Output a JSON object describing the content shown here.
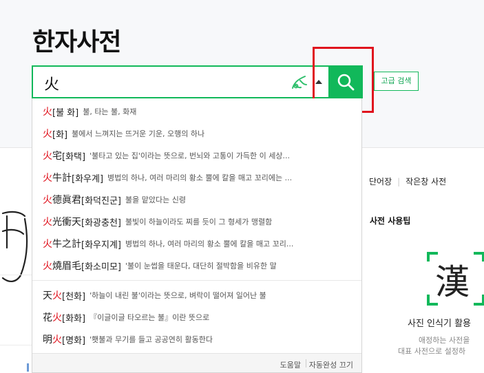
{
  "page": {
    "title": "한자사전"
  },
  "search": {
    "value": "火",
    "advanced_label": "고급 검색"
  },
  "autocomplete": {
    "group1": [
      {
        "pre": "",
        "hl": "火",
        "post": "",
        "reading": "[불 화]",
        "gloss": "불, 타는 불, 화재"
      },
      {
        "pre": "",
        "hl": "火",
        "post": "",
        "reading": "[화]",
        "gloss": "불에서 느껴지는 뜨거운 기운, 오행의 하나"
      },
      {
        "pre": "",
        "hl": "火",
        "post": "宅",
        "reading": "[화택]",
        "gloss": "'불타고 있는 집'이라는 뜻으로, 번뇌와 고통이 가득한 이 세상..."
      },
      {
        "pre": "",
        "hl": "火",
        "post": "牛計",
        "reading": "[화우계]",
        "gloss": "병법의 하나, 여러 마리의 황소 뿔에 칼을 매고 꼬리에는 ..."
      },
      {
        "pre": "",
        "hl": "火",
        "post": "德眞君",
        "reading": "[화덕진군]",
        "gloss": "불을 맡았다는 신령"
      },
      {
        "pre": "",
        "hl": "火",
        "post": "光衝天",
        "reading": "[화광충천]",
        "gloss": "불빛이 하늘이라도 찌를 듯이 그 형세가 맹렬함"
      },
      {
        "pre": "",
        "hl": "火",
        "post": "牛之計",
        "reading": "[화우지계]",
        "gloss": "병법의 하나, 여러 마리의 황소 뿔에 칼을 매고 꼬리..."
      },
      {
        "pre": "",
        "hl": "火",
        "post": "燒眉毛",
        "reading": "[화소미모]",
        "gloss": "'불이 눈썹을 태운다, 대단히 절박함을 비유한 말"
      }
    ],
    "group2": [
      {
        "pre": "天",
        "hl": "火",
        "post": "",
        "reading": "[천화]",
        "gloss": "'하늘이 내린 불'이라는 뜻으로, 벼락이 떨어져 일어난 불"
      },
      {
        "pre": "花",
        "hl": "火",
        "post": "",
        "reading": "[화화]",
        "gloss": "『이글이글 타오르는 불』이란 뜻으로"
      },
      {
        "pre": "明",
        "hl": "火",
        "post": "",
        "reading": "[명화]",
        "gloss": "'횃불과 무기를 들고 공공연히 활동한다"
      }
    ],
    "footer": {
      "help": "도움말",
      "auto_off": "자동완성 끄기"
    }
  },
  "sidebar": {
    "links": [
      "단어장",
      "작은창 사전"
    ],
    "tips_title": "사전 사용팁",
    "scanner": {
      "char": "漢",
      "title": "사진 인식기 활용",
      "desc1": "애정하는 사전을",
      "desc2": "대표 사전으로 설정하"
    }
  },
  "colors": {
    "brand": "#11b85a",
    "highlight": "#e0121d"
  },
  "icons": {
    "search": "search-icon",
    "handwrite": "handwrite-icon",
    "toggle": "triangle-up-icon"
  }
}
